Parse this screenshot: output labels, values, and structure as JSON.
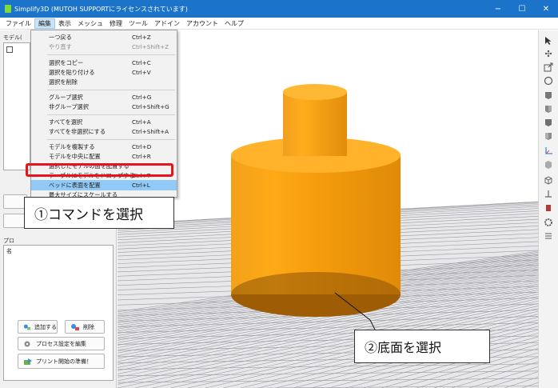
{
  "window": {
    "title": "Simplify3D (MUTOH SUPPORTにライセンスされています)",
    "min_glyph": "−",
    "max_glyph": "☐",
    "close_glyph": "✕"
  },
  "menubar": {
    "items": [
      "ファイル",
      "編集",
      "表示",
      "メッシュ",
      "修理",
      "ツール",
      "アドイン",
      "アカウント",
      "ヘルプ"
    ],
    "active": "編集"
  },
  "left_panel": {
    "models_label": "モデル(",
    "processes_label": "プロ",
    "process_row_fragment": "名",
    "add_button": "追加する",
    "delete_button": "削除",
    "edit_process_button": "プロセス設定を編集",
    "prepare_print_button": "プリント開始の準備！"
  },
  "edit_menu": {
    "items": [
      {
        "label": "一つ戻る",
        "shortcut": "Ctrl+Z",
        "disabled": false
      },
      {
        "label": "やり直す",
        "shortcut": "Ctrl+Shift+Z",
        "disabled": true
      },
      {
        "label": "選択をコピー",
        "shortcut": "Ctrl+C",
        "disabled": false
      },
      {
        "label": "選択を貼り付ける",
        "shortcut": "Ctrl+V",
        "disabled": false
      },
      {
        "label": "選択を削除",
        "shortcut": "",
        "disabled": false
      },
      {
        "label": "グループ選択",
        "shortcut": "Ctrl+G",
        "disabled": false
      },
      {
        "label": "非グループ選択",
        "shortcut": "Ctrl+Shift+G",
        "disabled": false
      },
      {
        "label": "すべてを選択",
        "shortcut": "Ctrl+A",
        "disabled": false
      },
      {
        "label": "すべてを非選択にする",
        "shortcut": "Ctrl+Shift+A",
        "disabled": false
      },
      {
        "label": "モデルを複製する",
        "shortcut": "Ctrl+D",
        "disabled": false
      },
      {
        "label": "モデルを中央に配置",
        "shortcut": "Ctrl+R",
        "disabled": false
      },
      {
        "label": "選択したモデルの面を配置する",
        "shortcut": "",
        "disabled": false
      },
      {
        "label": "テーブルにモデルをドロップする",
        "shortcut": "Ctrl+T",
        "disabled": false
      },
      {
        "label": "ベッドに表面を配置",
        "shortcut": "Ctrl+L",
        "disabled": false
      },
      {
        "label": "最大サイズにスケールする",
        "shortcut": "",
        "disabled": false
      }
    ]
  },
  "callouts": {
    "step1": "①コマンドを選択",
    "step2": "②底面を選択"
  },
  "toolbar_icons": [
    "select-arrow-icon",
    "move-icon",
    "scale-icon",
    "rotate-icon",
    "view-top-icon",
    "view-front-icon",
    "view-side-icon",
    "view-iso-icon",
    "axes-icon",
    "cube-icon",
    "mesh-icon",
    "ruler-icon",
    "paint-icon",
    "settings-gear-icon",
    "layers-icon"
  ],
  "colors": {
    "titlebar": "#1b74c9",
    "model_orange": "#f59b0c",
    "highlight": "#91c9f7",
    "red_box": "#e8141c"
  }
}
